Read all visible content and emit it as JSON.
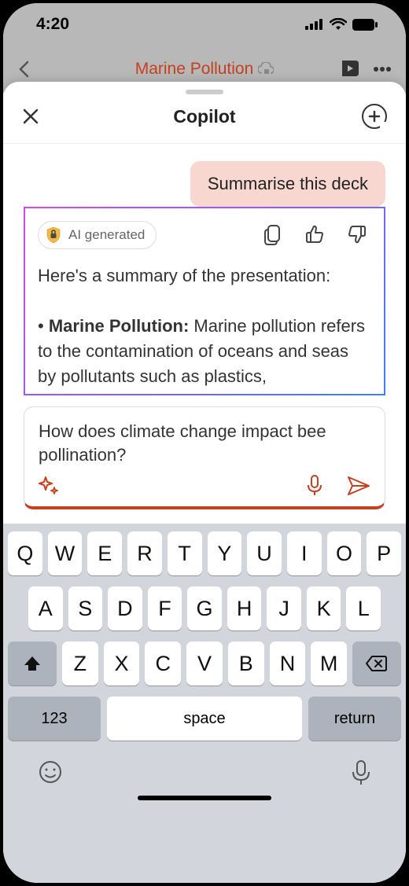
{
  "status": {
    "time": "4:20"
  },
  "bg": {
    "title": "Marine Pollution"
  },
  "sheet": {
    "title": "Copilot"
  },
  "chat": {
    "user_message": "Summarise this deck",
    "ai_badge": "AI generated",
    "response_intro": "Here's a summary of the presentation:",
    "bullet_label": "Marine Pollution:",
    "bullet_text": " Marine pollution refers to the contamination of oceans and seas by pollutants such as plastics,"
  },
  "input": {
    "text": "How does climate change impact bee pollination?"
  },
  "keyboard": {
    "row1": [
      "Q",
      "W",
      "E",
      "R",
      "T",
      "Y",
      "U",
      "I",
      "O",
      "P"
    ],
    "row2": [
      "A",
      "S",
      "D",
      "F",
      "G",
      "H",
      "J",
      "K",
      "L"
    ],
    "row3": [
      "Z",
      "X",
      "C",
      "V",
      "B",
      "N",
      "M"
    ],
    "numkey": "123",
    "space": "space",
    "return": "return"
  }
}
